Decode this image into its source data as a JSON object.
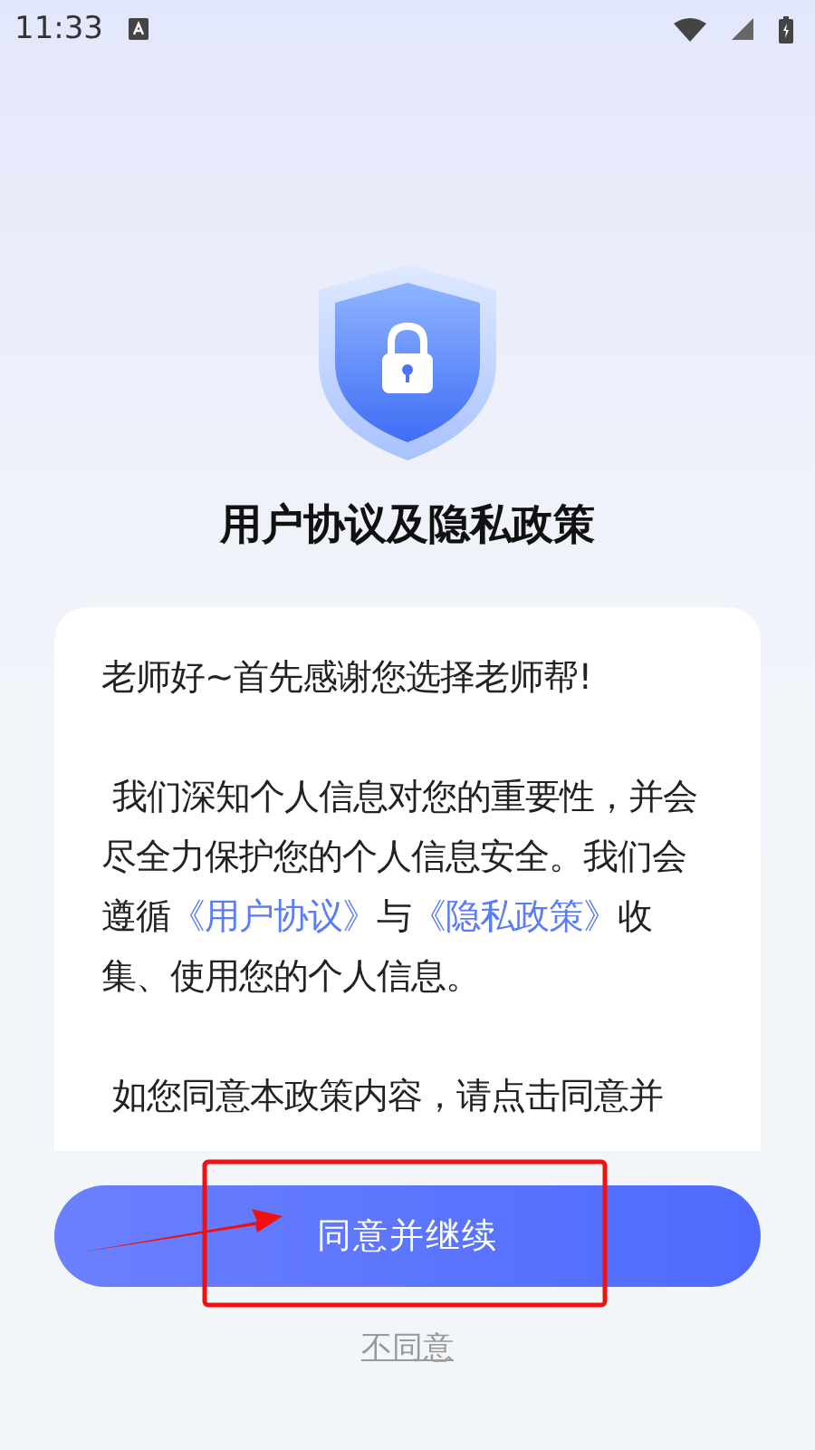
{
  "status_bar": {
    "time": "11:33"
  },
  "title": "用户协议及隐私政策",
  "paragraphs": [
    [
      {
        "kind": "text",
        "text": "老师好~首先感谢您选择老师帮!"
      }
    ],
    [
      {
        "kind": "text",
        "text": " 我们深知个人信息对您的重要性，并会尽全力保护您的个人信息安全。我们会遵循"
      },
      {
        "kind": "link",
        "text": "《用户协议》"
      },
      {
        "kind": "text",
        "text": "与"
      },
      {
        "kind": "link",
        "text": "《隐私政策》"
      },
      {
        "kind": "text",
        "text": "收集、使用您的个人信息。"
      }
    ],
    [
      {
        "kind": "text",
        "text": " 如您同意本政策内容，请点击同意并"
      }
    ]
  ],
  "agree_button": "同意并继续",
  "disagree_link": "不同意"
}
